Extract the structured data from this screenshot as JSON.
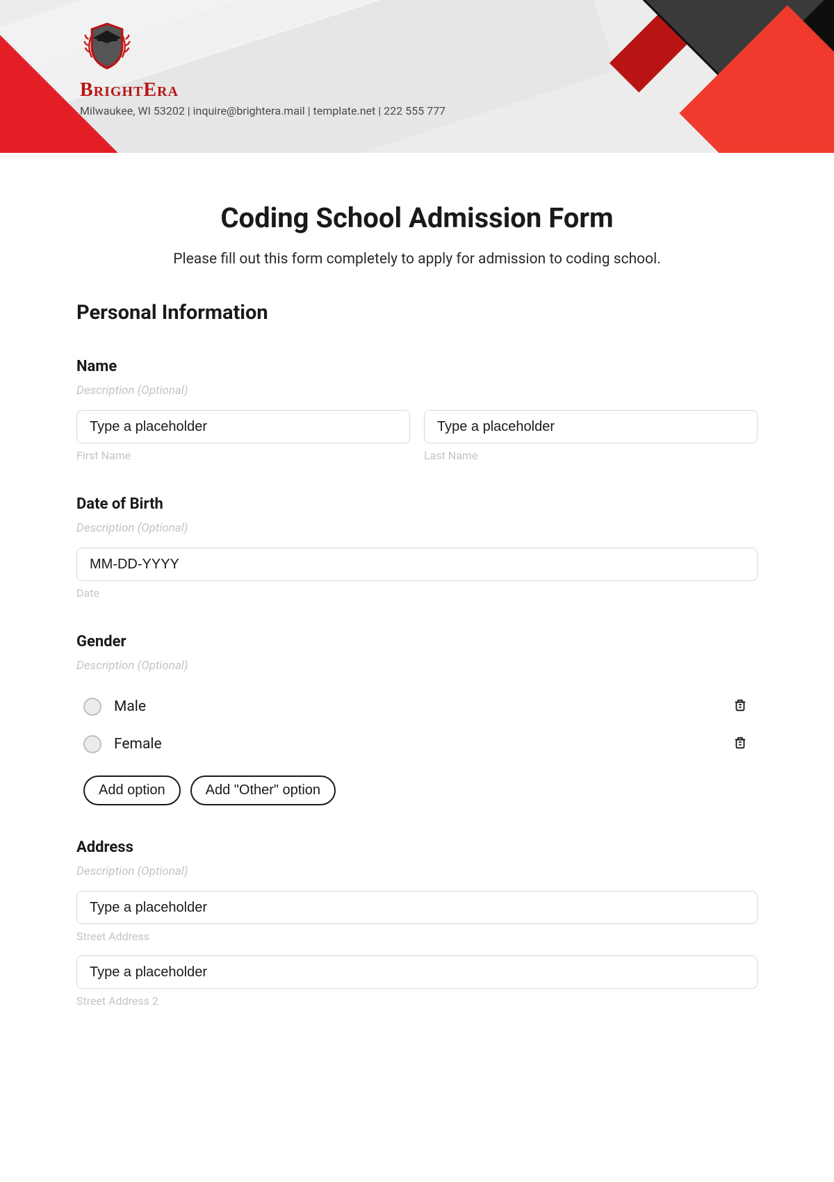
{
  "brand": {
    "name": "BrightEra",
    "subline": "Milwaukee, WI 53202 | inquire@brightera.mail | template.net | 222 555 777"
  },
  "form": {
    "title": "Coding School Admission Form",
    "subtitle": "Please fill out this form completely to apply for admission to coding school.",
    "sections": {
      "personal_info_heading": "Personal Information"
    },
    "name": {
      "label": "Name",
      "description": "Description (Optional)",
      "first_placeholder": "Type a placeholder",
      "first_sub": "First Name",
      "last_placeholder": "Type a placeholder",
      "last_sub": "Last Name"
    },
    "dob": {
      "label": "Date of Birth",
      "description": "Description (Optional)",
      "placeholder": "MM-DD-YYYY",
      "sub": "Date"
    },
    "gender": {
      "label": "Gender",
      "description": "Description (Optional)",
      "options": [
        {
          "label": "Male"
        },
        {
          "label": "Female"
        }
      ],
      "add_option_label": "Add option",
      "add_other_label": "Add \"Other\" option"
    },
    "address": {
      "label": "Address",
      "description": "Description (Optional)",
      "street1_placeholder": "Type a placeholder",
      "street1_sub": "Street Address",
      "street2_placeholder": "Type a placeholder",
      "street2_sub": "Street Address 2"
    }
  }
}
